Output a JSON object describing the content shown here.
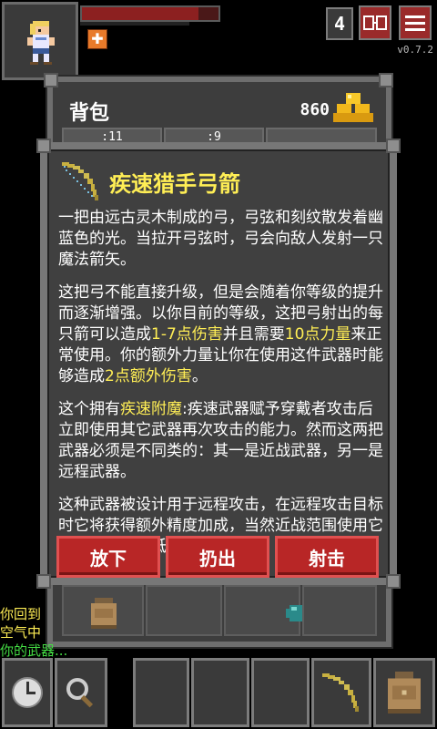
{
  "hud": {
    "depth": "4",
    "version": "v0.7.2",
    "hp_fraction": 0.85
  },
  "backpack": {
    "title": "背包",
    "gold": "860",
    "tabs": [
      ":11",
      ":9"
    ]
  },
  "item": {
    "title": "疾速猎手弓箭",
    "icon": "bow-icon",
    "paragraphs": [
      [
        {
          "t": "一把由远古灵木制成的弓，弓弦和刻纹散发着幽蓝色的光。当拉开弓弦时，弓会向敌人发射一只魔法箭矢。",
          "hl": false
        }
      ],
      [
        {
          "t": "这把弓不能直接升级，但是会随着你等级的提升而逐渐增强。以你目前的等级，这把弓射出的每只箭可以造成",
          "hl": false
        },
        {
          "t": "1-7点伤害",
          "hl": true
        },
        {
          "t": "并且需要",
          "hl": false
        },
        {
          "t": "10点力量",
          "hl": true
        },
        {
          "t": "来正常使用。你的额外力量让你在使用这件武器时能够造成",
          "hl": false
        },
        {
          "t": "2点额外伤害",
          "hl": true
        },
        {
          "t": "。",
          "hl": false
        }
      ],
      [
        {
          "t": "这个拥有",
          "hl": false
        },
        {
          "t": "疾速附魔",
          "hl": true
        },
        {
          "t": ":疾速武器赋予穿戴者攻击后立即使用其它武器再次攻击的能力。然而这两把武器必须是不同类的：其一是近战武器，另一是远程武器。",
          "hl": false
        }
      ],
      [
        {
          "t": "这种武器被设计用于远程攻击，在远程攻击目标时它将获得额外精度加成，当然近战范围使用它精准会大幅降低。",
          "hl": false
        }
      ]
    ],
    "buttons": {
      "drop": "放下",
      "throw": "扔出",
      "shoot": "射击"
    }
  },
  "log": [
    "你回到",
    "空气中",
    "你的武器..."
  ],
  "colors": {
    "highlight": "#ffee55",
    "button_red": "#b82626",
    "log_green": "#44dd44"
  }
}
